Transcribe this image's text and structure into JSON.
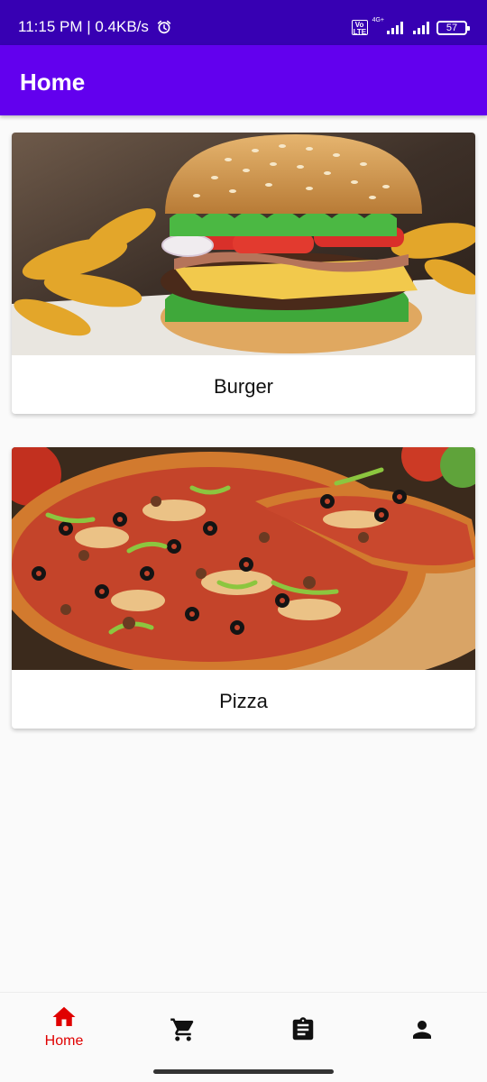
{
  "status_bar": {
    "time_speed": "11:15 PM | 0.4KB/s",
    "volte": "Vo LTE",
    "network": "4G+",
    "battery": "57"
  },
  "app_bar": {
    "title": "Home"
  },
  "cards": [
    {
      "label": "Burger",
      "image": "burger-image"
    },
    {
      "label": "Pizza",
      "image": "pizza-image"
    }
  ],
  "bottom_nav": {
    "items": [
      {
        "label": "Home",
        "icon": "home-icon",
        "selected": true
      },
      {
        "label": "",
        "icon": "cart-icon",
        "selected": false
      },
      {
        "label": "",
        "icon": "clipboard-icon",
        "selected": false
      },
      {
        "label": "",
        "icon": "person-icon",
        "selected": false
      }
    ],
    "accent_color": "#e00000"
  },
  "colors": {
    "status_bar": "#3700b3",
    "app_bar": "#6200ee",
    "background": "#fafafa"
  }
}
